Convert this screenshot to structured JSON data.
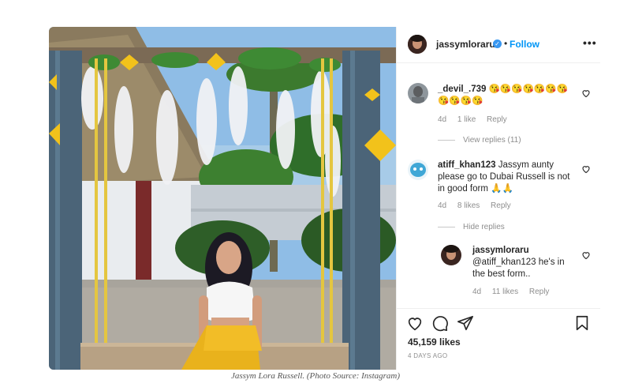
{
  "post": {
    "author": "jassymloraru",
    "follow_label": "Follow",
    "dot": "•",
    "more": "•••",
    "verified_glyph": "✓"
  },
  "comments": [
    {
      "user": "_devil_.739",
      "text": "😘😘😘😘😘😘😘😘😘😘😘",
      "time": "4d",
      "likes": "1 like",
      "reply": "Reply",
      "toggle": "View replies (11)"
    },
    {
      "user": "atiff_khan123",
      "text": "Jassym aunty please go to Dubai Russell is not in good form 🙏🙏",
      "time": "4d",
      "likes": "8 likes",
      "reply": "Reply",
      "toggle": "Hide replies"
    }
  ],
  "reply": {
    "user": "jassymloraru",
    "text": "@atiff_khan123 he's in the best form..",
    "time": "4d",
    "likes": "11 likes",
    "reply": "Reply"
  },
  "actions": {
    "like_count": "45,159 likes",
    "posted_ago": "4 DAYS AGO"
  },
  "caption": "Jassym Lora Russell. (Photo Source: Instagram)",
  "colors": {
    "link_blue": "#0095f6",
    "verified_blue": "#3897f0",
    "muted_gray": "#8e8e8e",
    "text": "#262626"
  }
}
